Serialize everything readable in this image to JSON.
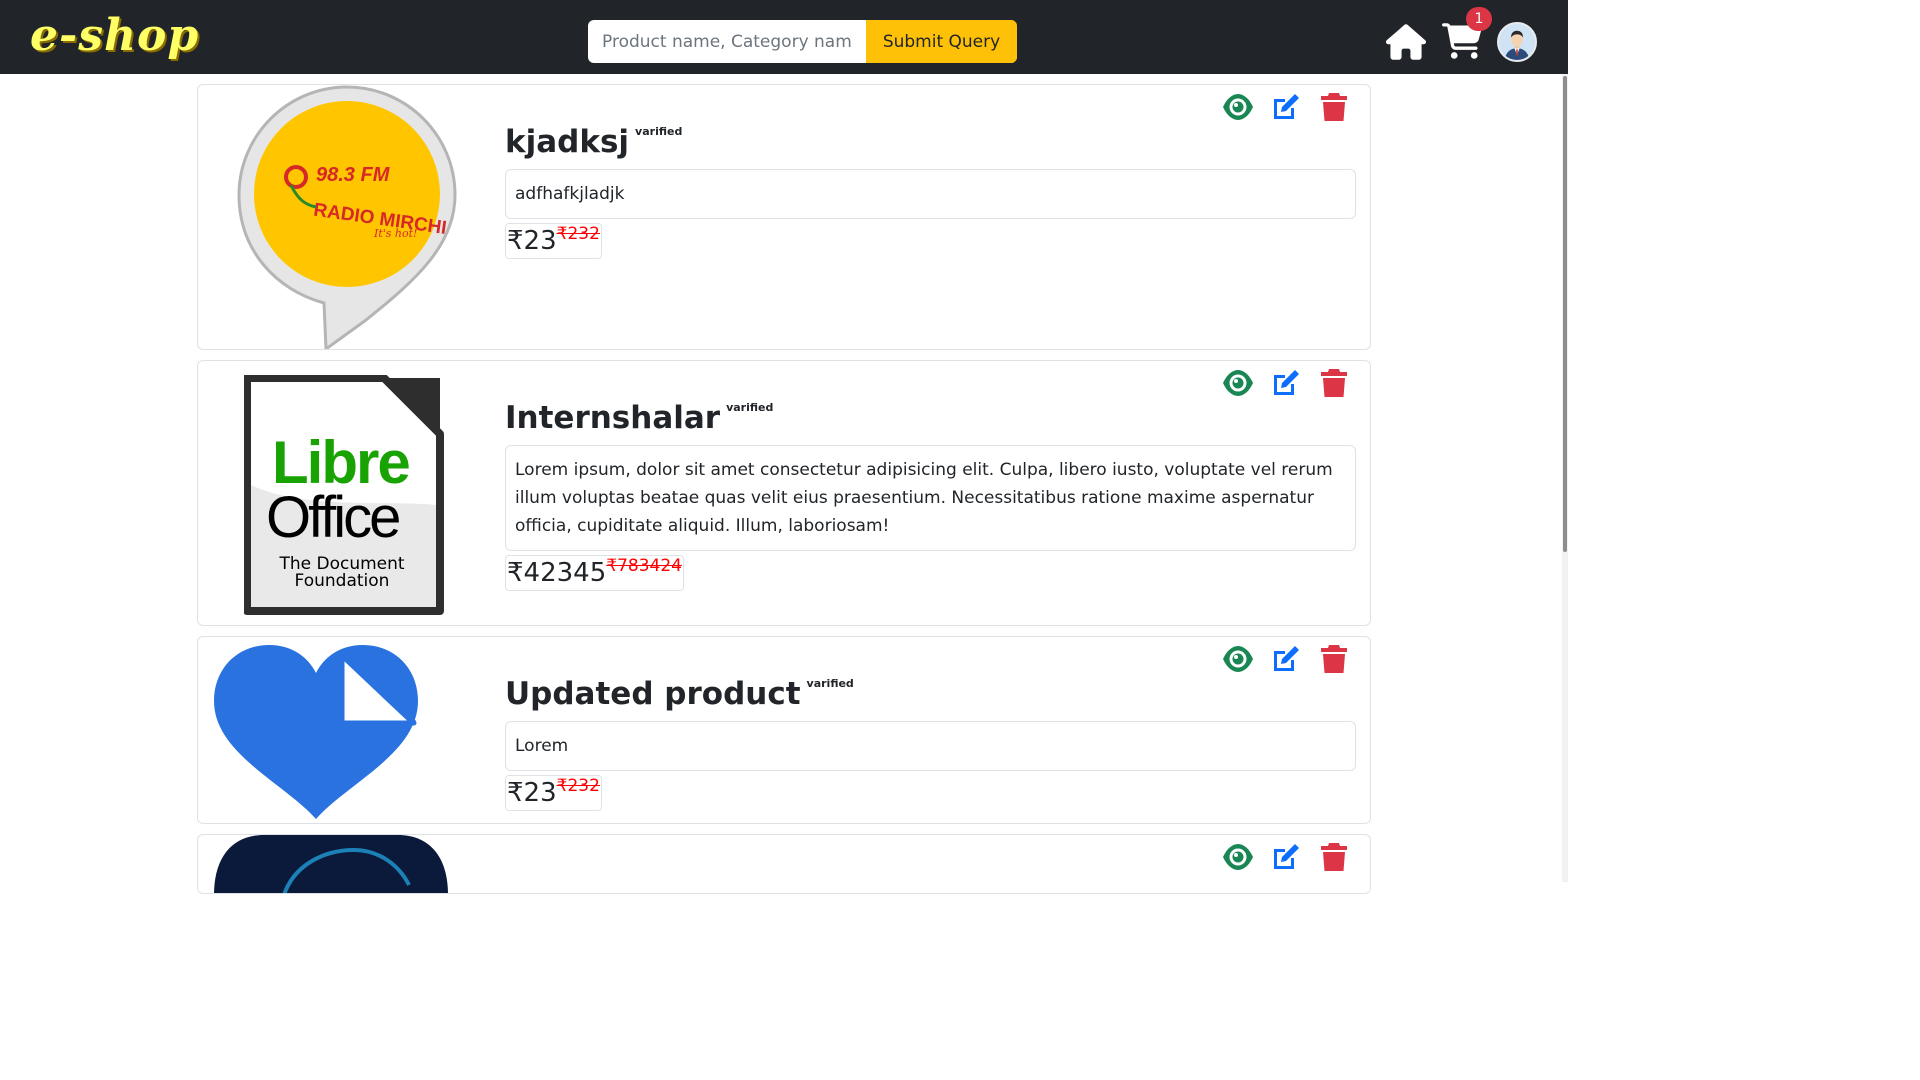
{
  "header": {
    "logo": "e-shop",
    "search_placeholder": "Product name, Category name",
    "search_value": "",
    "submit_label": "Submit Query",
    "cart_count": "1"
  },
  "products": [
    {
      "title": "kjadksj",
      "badge": "varified",
      "description": "adfhafkjladjk",
      "price": "₹23",
      "old_price": "₹232",
      "image": "radio-mirchi-logo"
    },
    {
      "title": "Internshalar",
      "badge": "varified",
      "description": "Lorem ipsum, dolor sit amet consectetur adipisicing elit. Culpa, libero iusto, voluptate vel rerum illum voluptas beatae quas velit eius praesentium. Necessitatibus ratione maxime aspernatur officia, cupiditate aliquid. Illum, laboriosam!",
      "price": "₹42345",
      "old_price": "₹783424",
      "image": "libreoffice-logo",
      "image_text": {
        "libre": "Libre",
        "office": "Office",
        "line1": "The Document",
        "line2": "Foundation"
      }
    },
    {
      "title": "Updated product",
      "badge": "varified",
      "description": "Lorem",
      "price": "₹23",
      "old_price": "₹232",
      "image": "heart-document-logo"
    },
    {
      "image": "dark-app-logo"
    }
  ],
  "icons": {
    "view": "eye-icon",
    "edit": "edit-icon",
    "delete": "trash-icon",
    "home": "home-icon",
    "cart": "cart-icon"
  },
  "colors": {
    "navbar": "#212529",
    "accent": "#ffc107",
    "view": "#198754",
    "edit": "#0d6efd",
    "delete": "#dc3545"
  }
}
